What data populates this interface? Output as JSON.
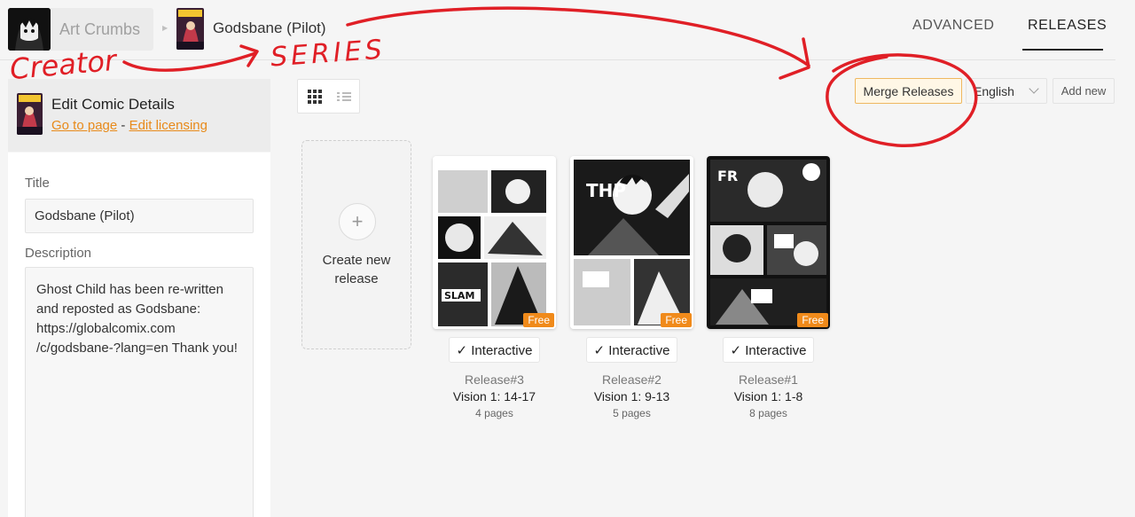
{
  "header": {
    "creator_name": "Art Crumbs",
    "series_title": "Godsbane (Pilot)",
    "tabs": [
      {
        "label": "ADVANCED",
        "active": false
      },
      {
        "label": "RELEASES",
        "active": true
      }
    ]
  },
  "panel": {
    "heading": "Edit Comic Details",
    "go_to_page": "Go to page",
    "separator": "-",
    "edit_licensing": "Edit licensing",
    "title_label": "Title",
    "title_value": "Godsbane (Pilot)",
    "description_label": "Description",
    "description_value": "Ghost Child has been re-written and reposted as Godsbane: https://globalcomix.com /c/godsbane-?lang=en Thank you!"
  },
  "toolbar": {
    "view_modes": [
      "grid-view",
      "list-view"
    ],
    "active_view": "grid-view",
    "merge_label": "Merge Releases",
    "language": "English",
    "add_label": "Add new"
  },
  "create_card": {
    "label": "Create new release",
    "plus": "+"
  },
  "releases": [
    {
      "number": "Release#3",
      "name": "Vision 1: 14-17",
      "pages": "4 pages",
      "badge": "Free",
      "interactive": "✓ Interactive"
    },
    {
      "number": "Release#2",
      "name": "Vision 1: 9-13",
      "pages": "5 pages",
      "badge": "Free",
      "interactive": "✓ Interactive"
    },
    {
      "number": "Release#1",
      "name": "Vision 1: 1-8",
      "pages": "8 pages",
      "badge": "Free",
      "interactive": "✓ Interactive"
    }
  ],
  "annotations": {
    "creator": "Creator",
    "series": "SERIES"
  },
  "colors": {
    "accent": "#e88a1a",
    "badge": "#f08a1a",
    "annotation": "#e01f26"
  }
}
